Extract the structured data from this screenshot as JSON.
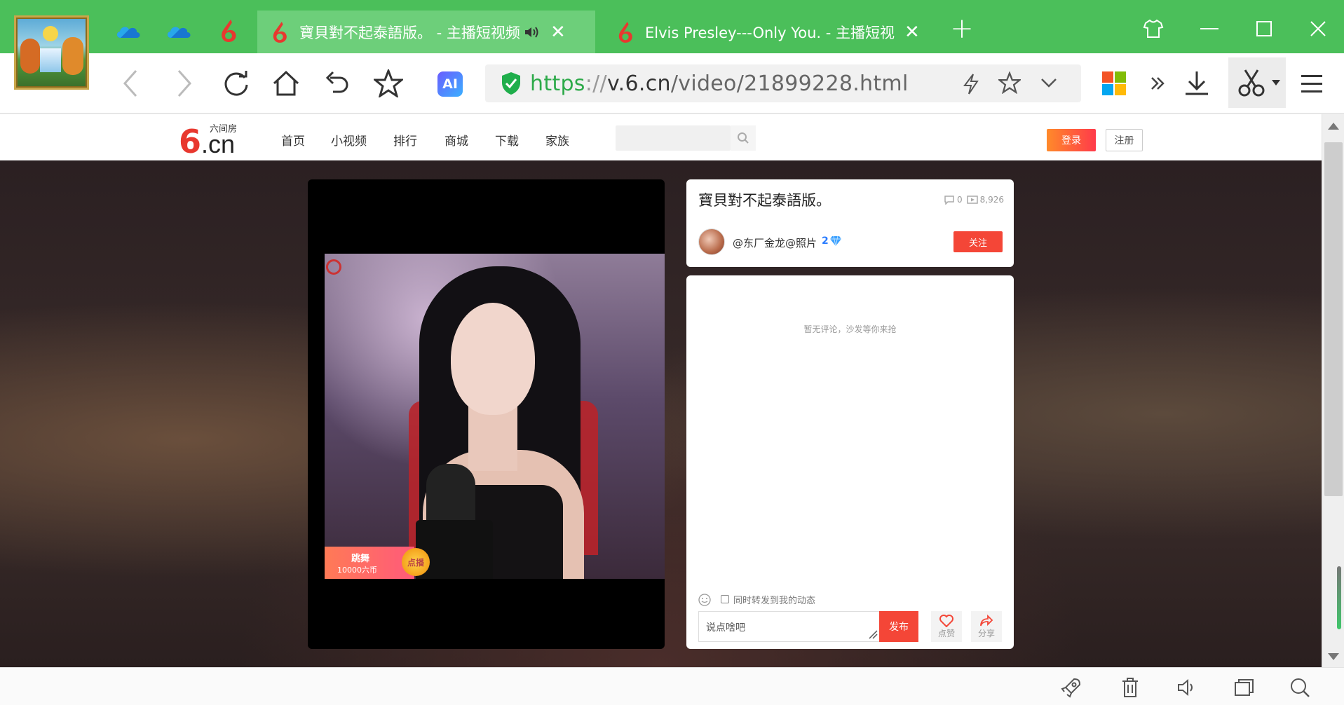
{
  "browser": {
    "tabs": [
      {
        "title": "寶貝對不起泰語版。 - 主播短视频",
        "active": true
      },
      {
        "title": "Elvis Presley---Only You. - 主播短视",
        "active": false
      }
    ],
    "new_tab_symbol": "+",
    "close_symbol": "✕",
    "url": {
      "scheme": "https",
      "sep": "://",
      "host": "v.6.cn",
      "path": "/video/21899228.html"
    },
    "ai_label": "AI",
    "accent_color": "#4bbf5a"
  },
  "site": {
    "logo_sub": "六间房",
    "logo_big": "6",
    "logo_domain": ".cn",
    "nav": [
      "首页",
      "小视频",
      "排行",
      "商城",
      "下载",
      "家族"
    ],
    "login_label": "登录",
    "register_label": "注册"
  },
  "video": {
    "title": "寶貝對不起泰語版。",
    "comment_count": "0",
    "view_count": "8,926",
    "author": "@东厂金龙@照片",
    "author_level": "2",
    "follow_label": "关注",
    "gift_title": "跳舞",
    "gift_price": "10000六币",
    "gift_button": "点播"
  },
  "comments": {
    "empty_text": "暂无评论，沙发等你来抢",
    "repost_label": "同时转发到我的动态",
    "input_placeholder": "说点啥吧",
    "post_label": "发布",
    "like_label": "点赞",
    "share_label": "分享"
  },
  "icons": {
    "onedrive": "cloud-icon",
    "six_rooms": "six-logo-icon",
    "speaker": "speaker-icon",
    "shirt": "skin-icon"
  }
}
